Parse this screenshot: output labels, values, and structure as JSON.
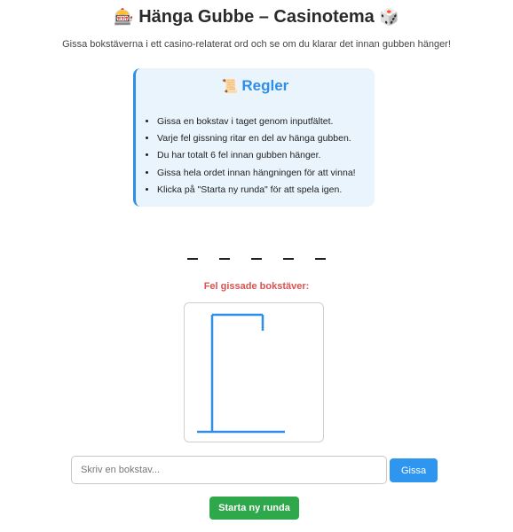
{
  "header": {
    "icon_left": "🎰",
    "title": "Hänga Gubbe – Casinotema",
    "icon_right": "🎲",
    "subtitle": "Gissa bokstäverna i ett casino-relaterat ord och se om du klarar det innan gubben hänger!"
  },
  "rules": {
    "icon": "📜",
    "title": "Regler",
    "items": [
      "Gissa en bokstav i taget genom inputfältet.",
      "Varje fel gissning ritar en del av hänga gubben.",
      "Du har totalt 6 fel innan gubben hänger.",
      "Gissa hela ordet innan hängningen för att vinna!",
      "Klicka på \"Starta ny runda\" för att spela igen."
    ]
  },
  "game": {
    "word_slots": [
      "_",
      "_",
      "_",
      "_",
      "_"
    ],
    "wrong_label": "Fel gissade bokstäver:",
    "wrong_letters": "",
    "gallows_color": "#2f8ee5"
  },
  "controls": {
    "input_placeholder": "Skriv en bokstav...",
    "input_value": "",
    "guess_label": "Gissa",
    "restart_label": "Starta ny runda"
  },
  "colors": {
    "accent": "#2f8ee5",
    "error": "#d9534f",
    "success": "#2ea84a"
  }
}
